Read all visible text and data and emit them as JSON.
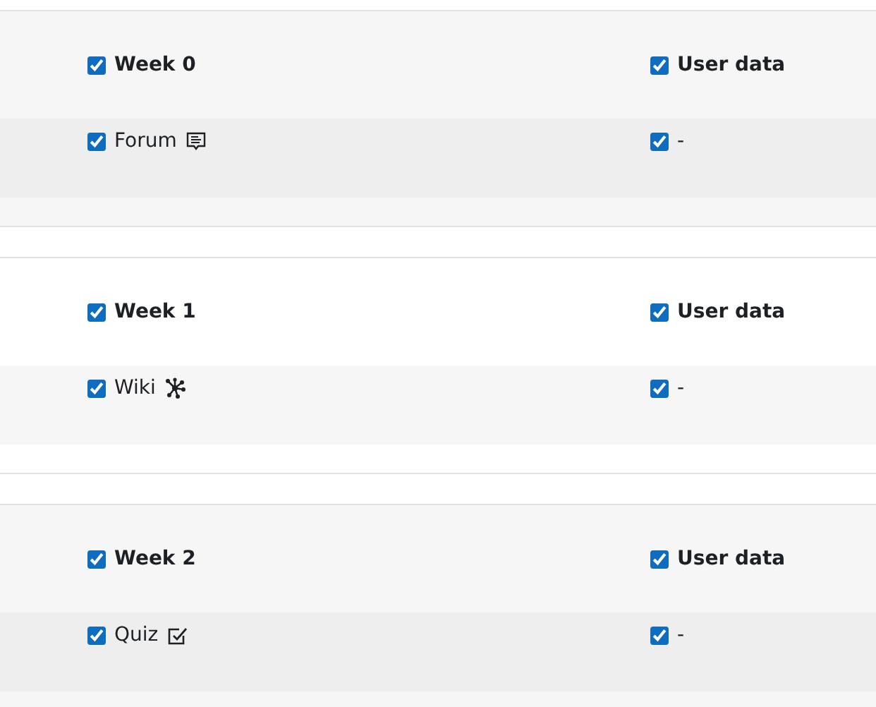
{
  "sections": [
    {
      "title": "Week 0",
      "checked": true,
      "user_data": {
        "label": "User data",
        "checked": true
      },
      "items": [
        {
          "name": "Forum",
          "kind": "forum",
          "checked": true,
          "user_data": {
            "label": "-",
            "checked": true
          }
        }
      ]
    },
    {
      "title": "Week 1",
      "checked": true,
      "user_data": {
        "label": "User data",
        "checked": true
      },
      "items": [
        {
          "name": "Wiki",
          "kind": "wiki",
          "checked": true,
          "user_data": {
            "label": "-",
            "checked": true
          }
        }
      ]
    },
    {
      "title": "Week 2",
      "checked": true,
      "user_data": {
        "label": "User data",
        "checked": true
      },
      "items": [
        {
          "name": "Quiz",
          "kind": "quiz",
          "checked": true,
          "user_data": {
            "label": "-",
            "checked": true
          }
        }
      ]
    }
  ]
}
